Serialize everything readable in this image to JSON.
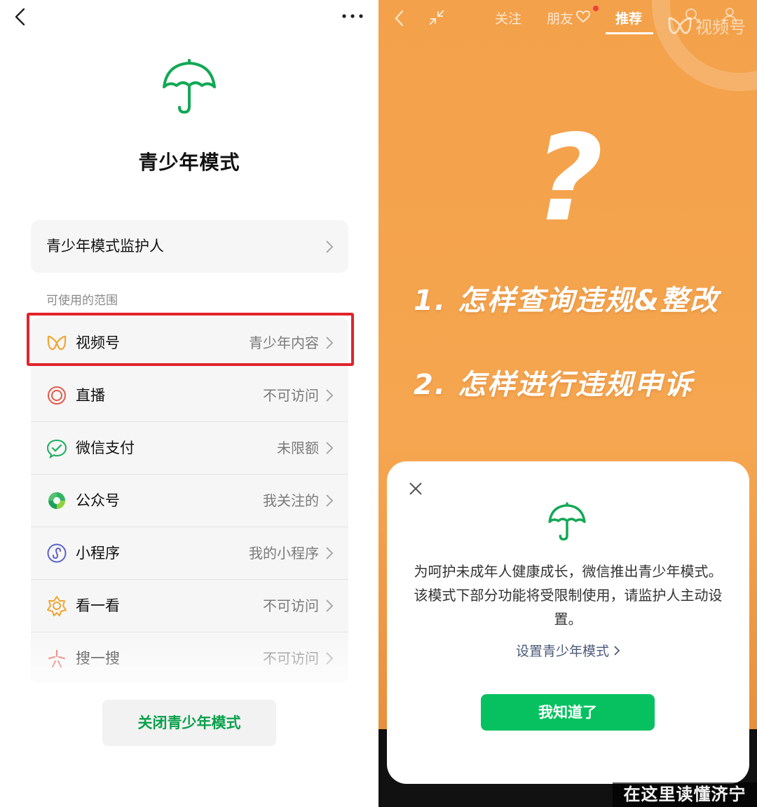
{
  "left": {
    "title": "青少年模式",
    "guardian_label": "青少年模式监护人",
    "section_label": "可使用的范围",
    "items": [
      {
        "label": "视频号",
        "value": "青少年内容",
        "icon": "channels-icon"
      },
      {
        "label": "直播",
        "value": "不可访问",
        "icon": "live-icon"
      },
      {
        "label": "微信支付",
        "value": "未限额",
        "icon": "wechat-pay-icon"
      },
      {
        "label": "公众号",
        "value": "我关注的",
        "icon": "official-accounts-icon"
      },
      {
        "label": "小程序",
        "value": "我的小程序",
        "icon": "mini-program-icon"
      },
      {
        "label": "看一看",
        "value": "不可访问",
        "icon": "top-stories-icon"
      },
      {
        "label": "搜一搜",
        "value": "不可访问",
        "icon": "search-icon"
      }
    ],
    "close_button": "关闭青少年模式"
  },
  "right": {
    "tabs": {
      "follow": "关注",
      "friends": "朋友",
      "recommend": "推荐"
    },
    "watermark": "视频号",
    "question_mark": "?",
    "promo_lines": [
      "1. 怎样查询违规&整改",
      "2. 怎样进行违规申诉"
    ],
    "sheet": {
      "description": "为呵护未成年人健康成长，微信推出青少年模式。该模式下部分功能将受限制使用，请监护人主动设置。",
      "link": "设置青少年模式",
      "confirm_button": "我知道了"
    }
  },
  "corner_watermark": "在这里读懂济宁",
  "colors": {
    "accent_green": "#07c160",
    "highlight_red": "#e0242c",
    "promo_orange": "#f3a14a"
  }
}
